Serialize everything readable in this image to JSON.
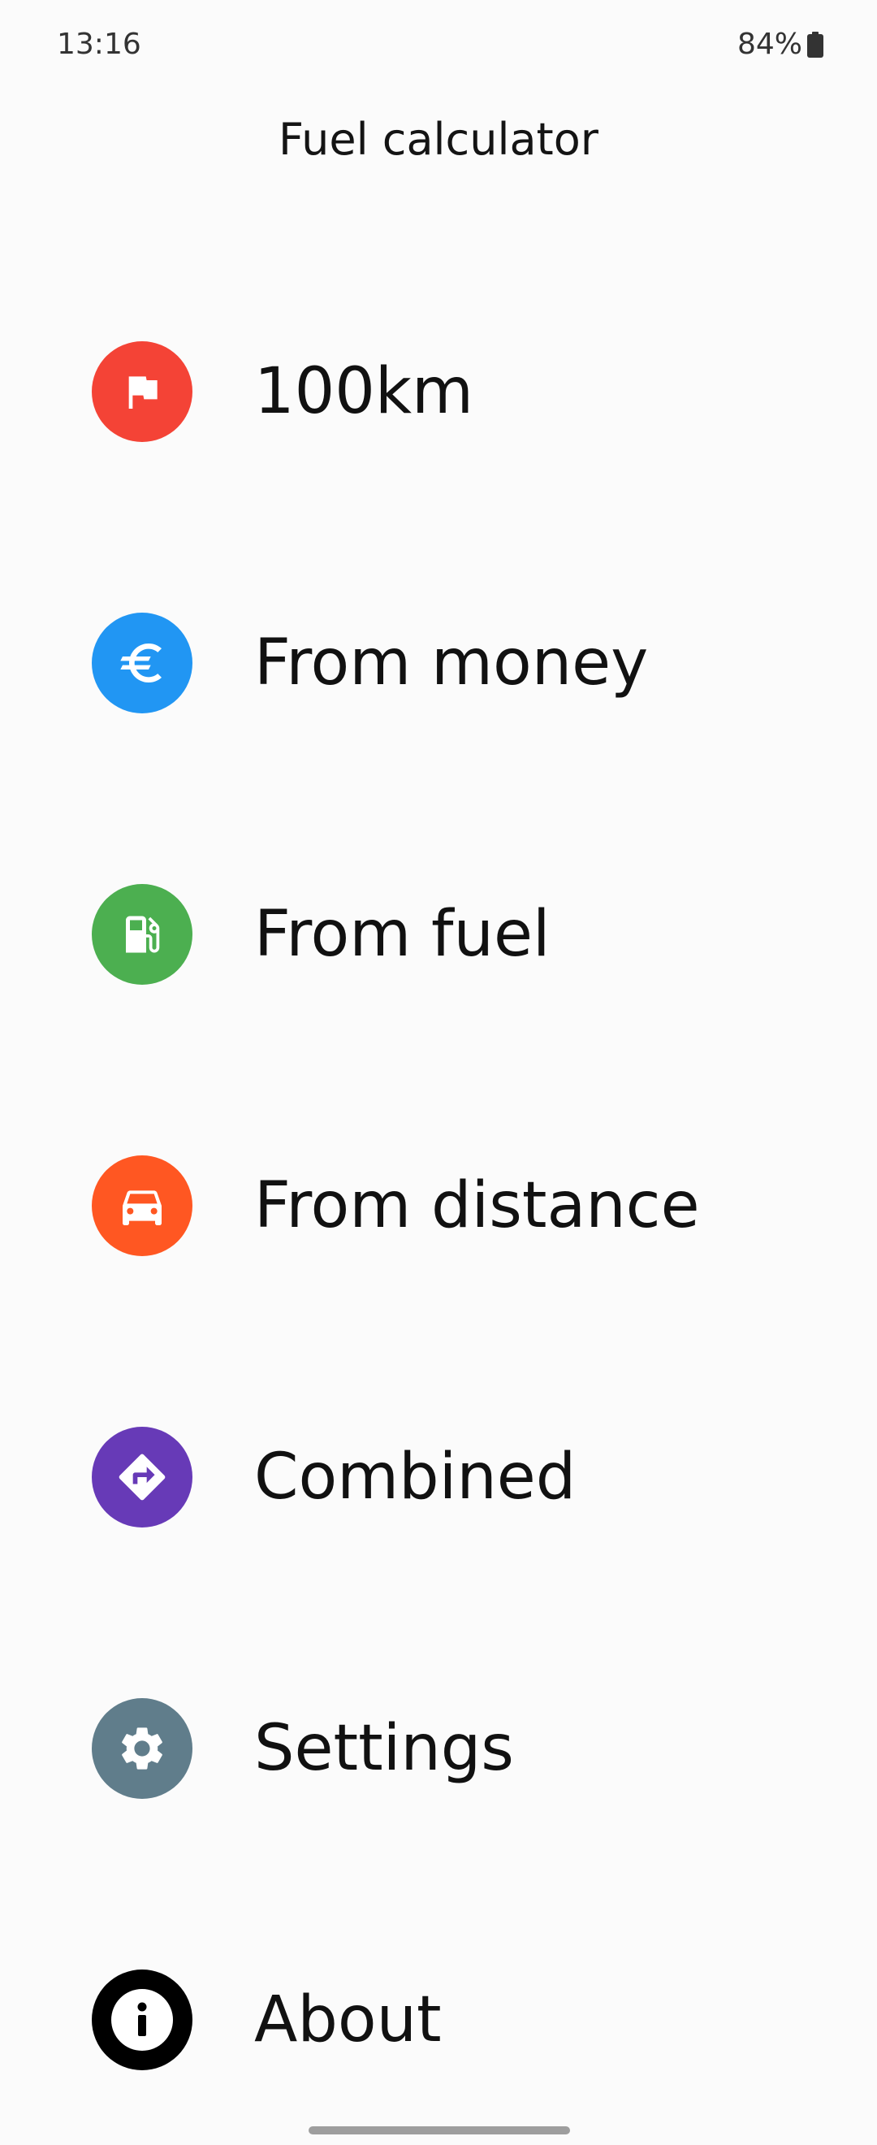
{
  "status_bar": {
    "time": "13:16",
    "battery": "84%"
  },
  "header": {
    "title": "Fuel calculator"
  },
  "menu": {
    "items": [
      {
        "label": "100km",
        "icon": "flag-icon",
        "color": "#f44336"
      },
      {
        "label": "From money",
        "icon": "euro-icon",
        "color": "#2196f3"
      },
      {
        "label": "From fuel",
        "icon": "fuel-pump-icon",
        "color": "#4caf50"
      },
      {
        "label": "From distance",
        "icon": "car-icon",
        "color": "#ff5722"
      },
      {
        "label": "Combined",
        "icon": "directions-icon",
        "color": "#673ab7"
      },
      {
        "label": "Settings",
        "icon": "gear-icon",
        "color": "#607d8b"
      },
      {
        "label": "About",
        "icon": "info-icon",
        "color": "#000000"
      }
    ]
  }
}
